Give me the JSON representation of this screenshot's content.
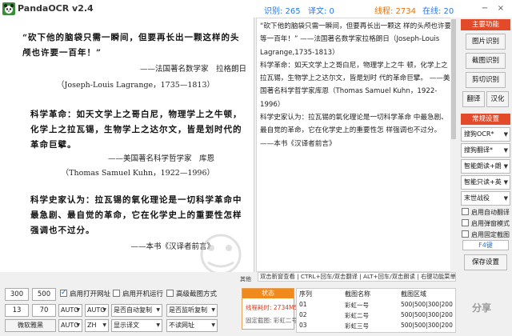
{
  "app": {
    "title": "PandaOCR v2.4",
    "stats": [
      {
        "label": "识别: 265",
        "color": "#2b78e4"
      },
      {
        "label": "译文: 0",
        "color": "#2b78e4"
      },
      {
        "label": "线程: 2734",
        "color": "#e8700a"
      },
      {
        "label": "在线: 20",
        "color": "#2b78e4"
      }
    ],
    "window_buttons": [
      "−",
      "×"
    ]
  },
  "source_image": {
    "paragraphs": [
      "“砍下他的脑袋只需一瞬间，但要再长出一颗这样的头颅也许要一百年！”",
      "科学革命：如天文学上之哥白尼，物理学上之牛顿，化学上之拉瓦锡，生物学上之达尔文，皆是划时代的革命巨擘。",
      "科学史家认为：拉瓦锡的氧化理论是一切科学革命中最急剧、最自觉的革命，它在化学史上的重要性怎样强调也不过分。"
    ],
    "attributions": [
      "——法国著名数学家　拉格朗日",
      "（Joseph-Louis Lagrange，1735—1813）",
      "——美国著名科学哲学家　库恩",
      "（Thomas Samuel Kuhn，1922—1996）",
      "——本书《汉译者前言》"
    ]
  },
  "ocr_result": {
    "text_lines": [
      "“砍下他的脑袋只需一瞬间，但要再长出一颗这 样的头颅也许要等一百年！” ——法国著名数学家拉格朗日（Joseph-Louis Lagrange,1735-1813）",
      "科学革命：如天文学上之哥白尼，物理学上之牛 顿，化学上之拉瓦锡，生物学上之达尔文，皆是划时 代的革命巨擘。 ——美国著名科学哲学家库恩（Thomas Samuel Kuhn，1922-1996）",
      "科学史家认为：拉瓦锡的氧化理论是一切科学革命 中最急剧、最自觉的革命，它在化学史上的重要性怎 样强调也不过分。 ——本书《汉译者前言》"
    ]
  },
  "sidebar": {
    "main_header": "主要功能",
    "main_buttons": [
      "图片识别",
      "截图识别",
      "剪切识别"
    ],
    "small_buttons": [
      "翻译",
      "汉化"
    ],
    "settings_header": "常规设置",
    "selects": [
      "搜狗OCR*",
      "搜狗翻译*",
      "智能朗读+朗",
      "智能只读+英",
      "末世战役"
    ],
    "checkboxes": [
      {
        "label": "启用自动翻译",
        "checked": false
      },
      {
        "label": "启用弹窗模式",
        "checked": false
      },
      {
        "label": "启用固定截图",
        "checked": false
      }
    ],
    "hotkey": "F4键",
    "save_button": "保存设置"
  },
  "bottom": {
    "other_label": "其他",
    "shortcut_hint": "双击新窗查看 | CTRL+回车/双击翻译 | ALT+回车/双击朗读 | 右键功能菜单",
    "row1": {
      "num_a": "300",
      "num_b": "500",
      "checks": [
        {
          "label": "启用打开网址",
          "checked": true
        },
        {
          "label": "启用开机运行",
          "checked": false
        },
        {
          "label": "高级截图方式",
          "checked": false
        }
      ]
    },
    "row2": {
      "num_a": "13",
      "num_b": "70",
      "selects": [
        "AUTO",
        "AUTO",
        "是否自动复制",
        "是否监听复制"
      ]
    },
    "row3": {
      "button": "微软雅黑",
      "selects": [
        "AUTO",
        "ZH",
        "显示译文",
        "不读网址"
      ]
    },
    "status": {
      "header": "状态",
      "line1": "线程耗时: 2734MS",
      "line2": "固定截图: 彩虹二号"
    },
    "table": {
      "headers": [
        "序列",
        "截图名称",
        "截图区域"
      ],
      "rows": [
        {
          "index": "01",
          "name": "彩虹一号",
          "region": "500|500|300|200"
        },
        {
          "index": "02",
          "name": "彩虹二号",
          "region": "500|500|300|200"
        },
        {
          "index": "03",
          "name": "彩虹三号",
          "region": "500|500|300|200"
        }
      ]
    },
    "watermark_badge": "分享"
  },
  "colors": {
    "accent_red": "#e24a2a",
    "status_orange": "#f08a1c",
    "link_blue": "#2b78e4"
  }
}
